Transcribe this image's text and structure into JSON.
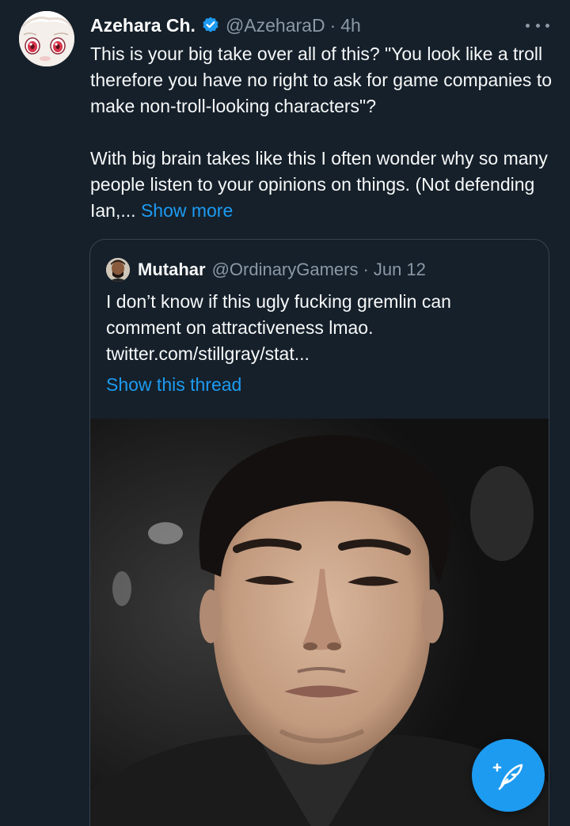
{
  "tweet": {
    "author": {
      "display_name": "Azehara Ch.",
      "handle": "@AzeharaD",
      "verified": true
    },
    "separator": "·",
    "timestamp": "4h",
    "paragraphs": [
      "This is your big take over all of this?  \"You look like a troll therefore you have no right to ask for game companies to make non-troll-looking characters\"?",
      "With big brain takes like this I often wonder why so many people listen to your opinions on things.  (Not defending Ian,..."
    ],
    "show_more_label": "Show more",
    "more_icon": "more-horizontal-icon"
  },
  "quoted_tweet": {
    "author": {
      "display_name": "Mutahar",
      "handle": "@OrdinaryGamers"
    },
    "separator": "·",
    "timestamp": "Jun 12",
    "lines": [
      "I don’t know if this ugly fucking gremlin can",
      "comment on attractiveness lmao.",
      "twitter.com/stillgray/stat..."
    ],
    "show_thread_label": "Show this thread"
  },
  "fab": {
    "icon": "compose-feather-icon"
  },
  "colors": {
    "background": "#15202b",
    "accent": "#1d9bf0",
    "secondary_text": "#8b98a5",
    "border": "#38444d"
  }
}
